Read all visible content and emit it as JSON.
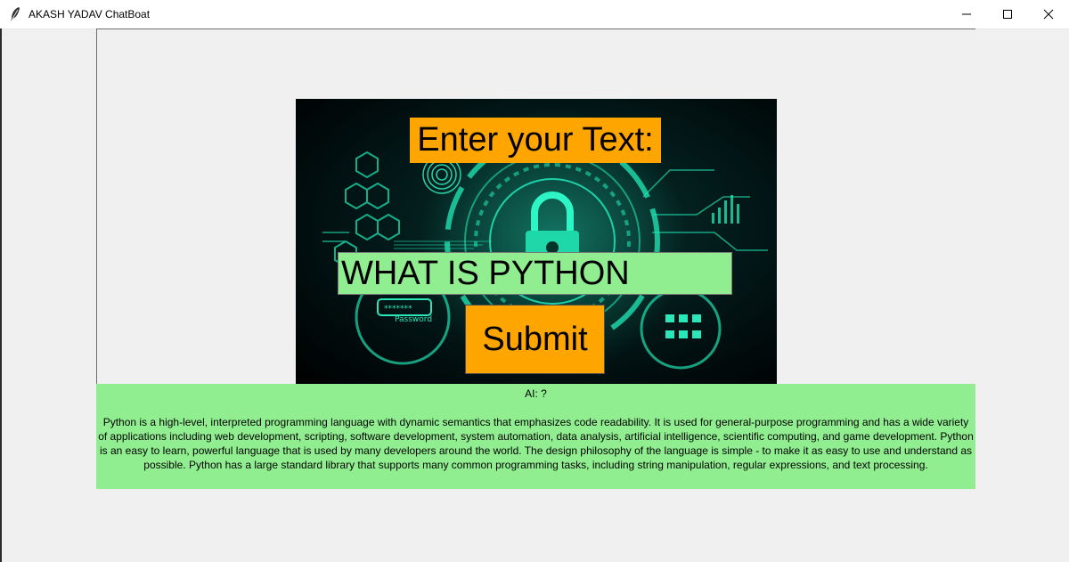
{
  "window": {
    "title": "AKASH YADAV ChatBoat",
    "icons": {
      "app": "feather-icon",
      "minimize": "minimize-icon",
      "maximize": "maximize-icon",
      "close": "close-icon"
    }
  },
  "hero": {
    "image": "cyber-security-padlock-background",
    "overlay_text": "Password"
  },
  "prompt": {
    "label": "Enter your Text:"
  },
  "entry": {
    "value": "WHAT IS PYTHON"
  },
  "submit": {
    "label": "Submit"
  },
  "response": {
    "ai_prefix": "AI: ?",
    "text": "Python is a high-level, interpreted programming language with dynamic semantics that emphasizes code readability. It is used for general-purpose programming and has a wide variety of applications including web development, scripting, software development, system automation, data analysis, artificial intelligence, scientific computing, and game development. Python is an easy to learn, powerful language that is used by many developers around the world. The design philosophy of the language is simple - to make it as easy to use and understand as possible. Python has a large standard library that supports many common programming tasks, including string manipulation, regular expressions, and text processing."
  },
  "colors": {
    "label_bg": "#ffa500",
    "entry_bg": "#90ee90",
    "response_bg": "#90ee90",
    "window_bg": "#f0f0f0",
    "hero_accent": "#1fe0b0"
  }
}
